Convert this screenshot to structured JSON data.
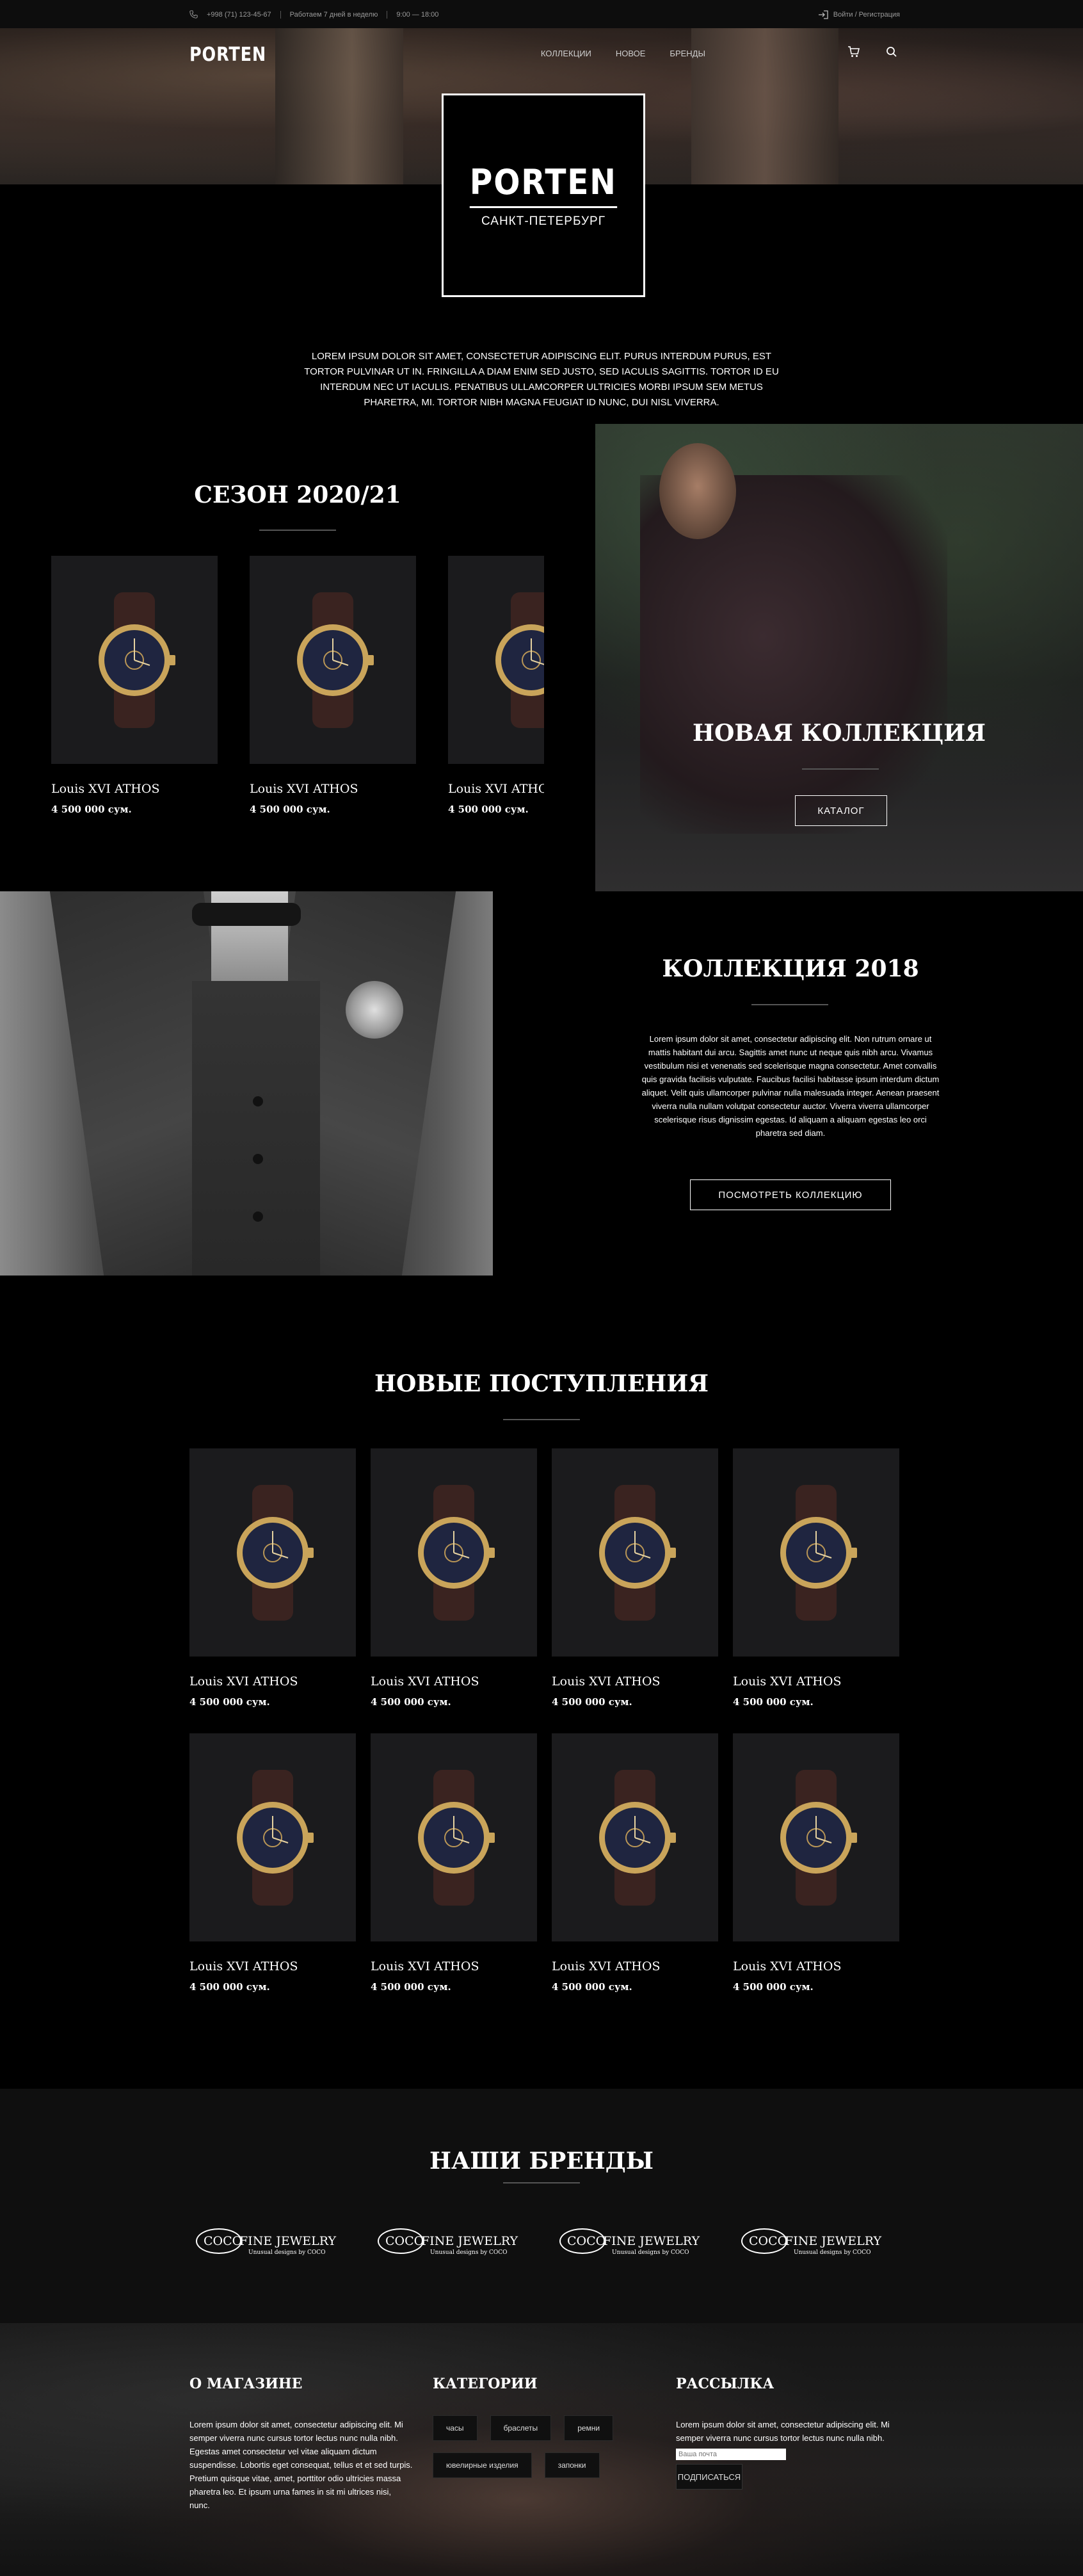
{
  "topbar": {
    "phone": "+998 (71) 123-45-67",
    "schedule": "Работаем 7 дней в неделю",
    "hours": "9:00 — 18:00",
    "auth": "Войти / Регистрация"
  },
  "header": {
    "logo": "PORTEN",
    "nav": [
      "КОЛЛЕКЦИИ",
      "НОВОЕ",
      "БРЕНДЫ"
    ],
    "cart_icon": "cart-icon",
    "search_icon": "search-icon"
  },
  "hero": {
    "logo": "PORTEN",
    "city": "САНКТ-ПЕТЕРБУРГ",
    "intro": "LOREM IPSUM DOLOR SIT AMET, CONSECTETUR ADIPISCING ELIT. PURUS INTERDUM PURUS, EST TORTOR PULVINAR UT IN. FRINGILLA A DIAM ENIM SED JUSTO, SED IACULIS SAGITTIS. TORTOR ID EU INTERDUM NEC UT IACULIS. PENATIBUS ULLAMCORPER ULTRICIES MORBI IPSUM SEM METUS PHARETRA, MI. TORTOR NIBH MAGNA FEUGIAT ID NUNC, DUI NISL VIVERRA."
  },
  "season": {
    "title": "СЕЗОН 2020/21",
    "products": [
      {
        "name": "Louis XVI ATHOS",
        "price": "4 500 000 сум."
      },
      {
        "name": "Louis XVI ATHOS",
        "price": "4 500 000 сум."
      },
      {
        "name": "Louis XVI ATHOS",
        "price": "4 500 000 сум."
      }
    ]
  },
  "new_collection": {
    "title": "НОВАЯ КОЛЛЕКЦИЯ",
    "button": "КАТАЛОГ"
  },
  "collection2018": {
    "title": "КОЛЛЕКЦИЯ 2018",
    "text": "Lorem ipsum dolor sit amet, consectetur adipiscing elit. Non rutrum ornare ut mattis habitant dui arcu. Sagittis amet nunc ut neque quis nibh arcu. Vivamus vestibulum nisi et venenatis sed scelerisque magna consectetur. Amet convallis quis gravida facilisis vulputate. Faucibus facilisi habitasse ipsum interdum dictum aliquet. Velit quis ullamcorper pulvinar nulla malesuada integer. Aenean praesent viverra nulla nullam volutpat consectetur auctor. Viverra viverra ullamcorper scelerisque risus dignissim egestas. Id aliquam a aliquam egestas leo orci pharetra sed diam.",
    "button": "ПОСМОТРЕТЬ КОЛЛЕКЦИЮ"
  },
  "arrivals": {
    "title": "НОВЫЕ ПОСТУПЛЕНИЯ",
    "products": [
      {
        "name": "Louis XVI ATHOS",
        "price": "4 500 000 сум."
      },
      {
        "name": "Louis XVI ATHOS",
        "price": "4 500 000 сум."
      },
      {
        "name": "Louis XVI ATHOS",
        "price": "4 500 000 сум."
      },
      {
        "name": "Louis XVI ATHOS",
        "price": "4 500 000 сум."
      },
      {
        "name": "Louis XVI ATHOS",
        "price": "4 500 000 сум."
      },
      {
        "name": "Louis XVI ATHOS",
        "price": "4 500 000 сум."
      },
      {
        "name": "Louis XVI ATHOS",
        "price": "4 500 000 сум."
      },
      {
        "name": "Louis XVI ATHOS",
        "price": "4 500 000 сум."
      }
    ]
  },
  "brands": {
    "title": "НАШИ БРЕНДЫ",
    "items": [
      {
        "oval": "COCO",
        "name": "FINE JEWELRY",
        "tagline": "Unusual designs by COCO"
      },
      {
        "oval": "COCO",
        "name": "FINE JEWELRY",
        "tagline": "Unusual designs by COCO"
      },
      {
        "oval": "COCO",
        "name": "FINE JEWELRY",
        "tagline": "Unusual designs by COCO"
      },
      {
        "oval": "COCO",
        "name": "FINE JEWELRY",
        "tagline": "Unusual designs by COCO"
      }
    ]
  },
  "footer": {
    "about_title": "О МАГАЗИНЕ",
    "about_text": "Lorem ipsum dolor sit amet, consectetur adipiscing elit. Mi semper viverra nunc cursus tortor lectus nunc nulla nibh. Egestas amet consectetur vel vitae aliquam dictum suspendisse. Lobortis eget consequat, tellus et et sed turpis. Pretium quisque vitae, amet, porttitor odio ultricies massa pharetra leo. Et ipsum urna fames in sit mi ultrices nisi, nunc.",
    "categories_title": "КАТЕГОРИИ",
    "categories": [
      "часы",
      "браслеты",
      "ремни",
      "ювелирные изделия",
      "запонки"
    ],
    "newsletter_title": "РАССЫЛКА",
    "newsletter_text": "Lorem ipsum dolor sit amet, consectetur adipiscing elit. Mi semper viverra nunc cursus tortor lectus nunc nulla nibh.",
    "email_placeholder": "Ваша почта",
    "subscribe": "ПОДПИСАТЬСЯ"
  }
}
